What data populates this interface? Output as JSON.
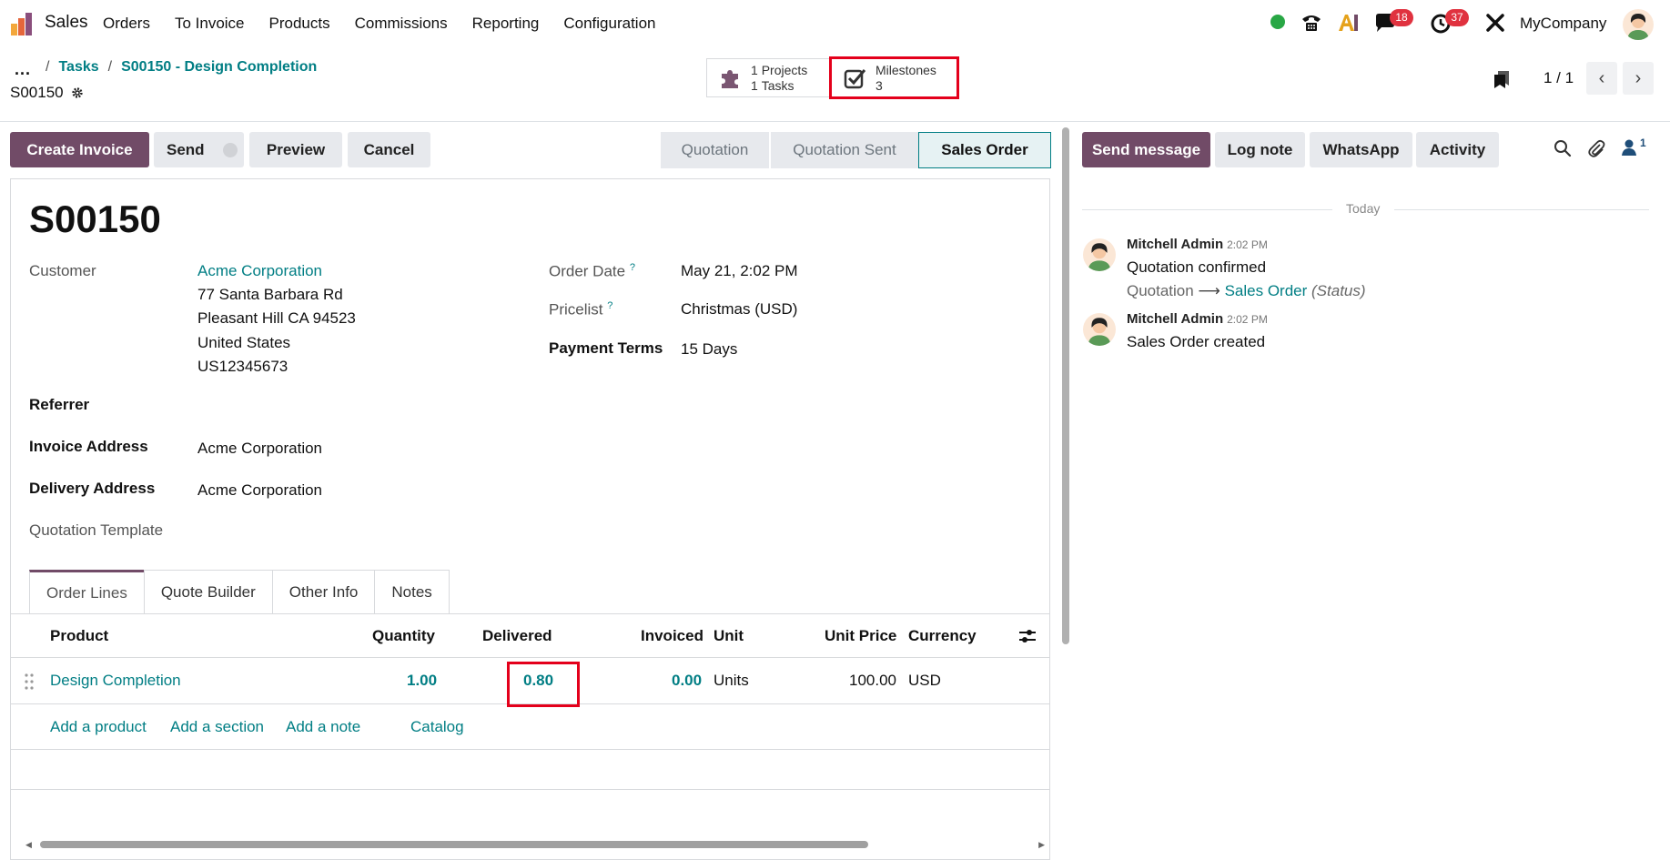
{
  "navbar": {
    "app_name": "Sales",
    "menu": [
      "Orders",
      "To Invoice",
      "Products",
      "Commissions",
      "Reporting",
      "Configuration"
    ],
    "messages_count": "18",
    "activities_count": "37",
    "company": "MyCompany"
  },
  "breadcrumb": {
    "ellipsis": "...",
    "sep1": "/",
    "tasks": "Tasks",
    "sep2": "/",
    "current": "S00150 - Design Completion"
  },
  "record_name": "S00150",
  "smart_buttons": {
    "projects_count": "1",
    "projects_label": "Projects",
    "tasks_count": "1",
    "tasks_label": "Tasks",
    "milestones_label": "Milestones",
    "milestones_count": "3"
  },
  "pager": {
    "value": "1 / 1"
  },
  "actions": {
    "create_invoice": "Create Invoice",
    "send": "Send",
    "preview": "Preview",
    "cancel": "Cancel"
  },
  "statusbar": {
    "stages": [
      "Quotation",
      "Quotation Sent",
      "Sales Order"
    ],
    "active": "Sales Order"
  },
  "form": {
    "title": "S00150",
    "customer_label": "Customer",
    "customer_name": "Acme Corporation",
    "address_line1": "77 Santa Barbara Rd",
    "address_line2": "Pleasant Hill CA 94523",
    "address_line3": "United States",
    "address_line4": "US12345673",
    "order_date_label": "Order Date",
    "order_date": "May 21, 2:02 PM",
    "pricelist_label": "Pricelist",
    "pricelist": "Christmas (USD)",
    "payment_terms_label": "Payment Terms",
    "payment_terms": "15 Days",
    "referrer_label": "Referrer",
    "invoice_address_label": "Invoice Address",
    "invoice_address": "Acme Corporation",
    "delivery_address_label": "Delivery Address",
    "delivery_address": "Acme Corporation",
    "quotation_template_label": "Quotation Template",
    "help_mark": "?"
  },
  "tabs": [
    "Order Lines",
    "Quote Builder",
    "Other Info",
    "Notes"
  ],
  "order_lines": {
    "headers": {
      "product": "Product",
      "quantity": "Quantity",
      "delivered": "Delivered",
      "invoiced": "Invoiced",
      "unit": "Unit",
      "unit_price": "Unit Price",
      "currency": "Currency"
    },
    "rows": [
      {
        "product": "Design Completion",
        "quantity": "1.00",
        "delivered": "0.80",
        "invoiced": "0.00",
        "unit": "Units",
        "unit_price": "100.00",
        "currency": "USD"
      }
    ],
    "add_product": "Add a product",
    "add_section": "Add a section",
    "add_note": "Add a note",
    "catalog": "Catalog"
  },
  "chatter": {
    "send_message": "Send message",
    "log_note": "Log note",
    "whatsapp": "WhatsApp",
    "activity": "Activity",
    "followers_count": "1",
    "today": "Today",
    "messages": [
      {
        "author": "Mitchell Admin",
        "time": "2:02 PM",
        "body": "Quotation confirmed",
        "track_old": "Quotation",
        "track_arrow": "⟶",
        "track_new": "Sales Order",
        "track_field": "(Status)"
      },
      {
        "author": "Mitchell Admin",
        "time": "2:02 PM",
        "body": "Sales Order created"
      }
    ]
  },
  "colors": {
    "brand": "#714b67",
    "link": "#017e84",
    "highlight": "#e4001b",
    "badge": "#e0323f"
  }
}
